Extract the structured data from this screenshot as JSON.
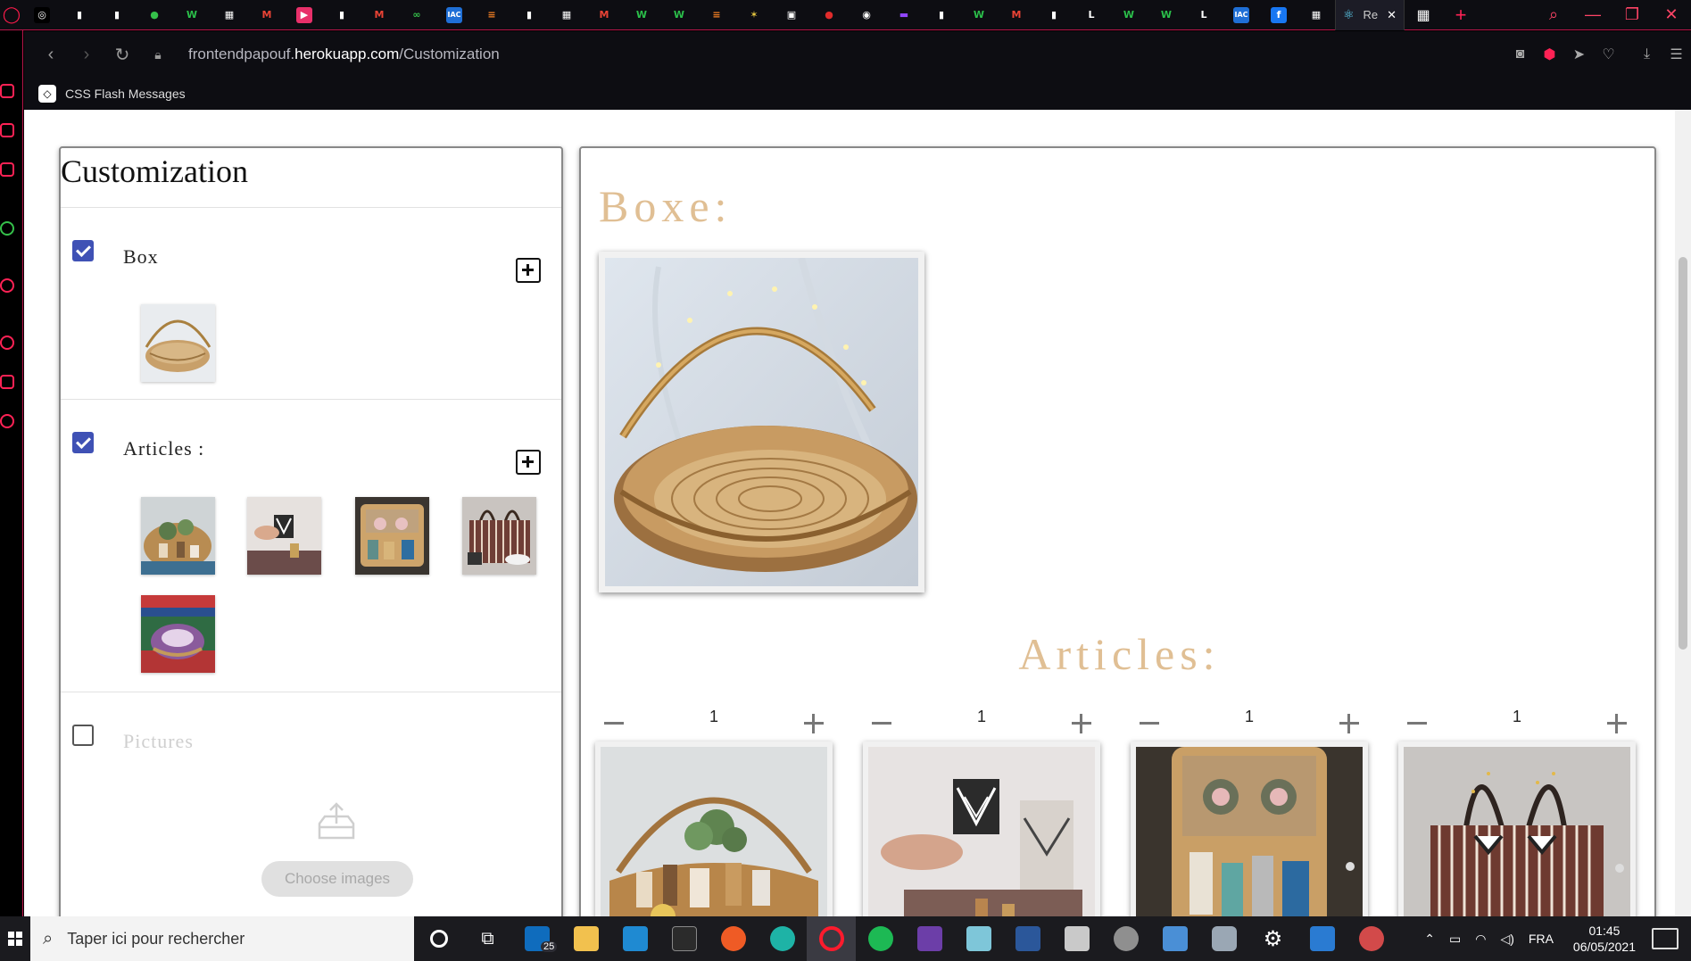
{
  "browser": {
    "active_tab_title": "Re",
    "url_prefix": "frontendpapouf.",
    "url_domain": "herokuapp.com",
    "url_path": "/Customization",
    "bookmark_label": "CSS Flash Messages",
    "tab_favicons": [
      {
        "name": "codepen-tab",
        "glyph": "◎",
        "color": "#ffffff",
        "bg": "#000000"
      },
      {
        "name": "doc-tab",
        "glyph": "▮",
        "color": "#ffffff",
        "bg": "transparent"
      },
      {
        "name": "doc-tab",
        "glyph": "▮",
        "color": "#ffffff",
        "bg": "transparent"
      },
      {
        "name": "green-tab",
        "glyph": "●",
        "color": "#35c04a",
        "bg": "transparent"
      },
      {
        "name": "w-tab",
        "glyph": "W",
        "color": "#2bbf4a",
        "bg": "transparent"
      },
      {
        "name": "grid-tab",
        "glyph": "▦",
        "color": "#ffffff",
        "bg": "transparent"
      },
      {
        "name": "gmail-tab",
        "glyph": "M",
        "color": "#ea4335",
        "bg": "transparent"
      },
      {
        "name": "play-tab",
        "glyph": "▶",
        "color": "#ffffff",
        "bg": "#e8306a"
      },
      {
        "name": "doc-tab",
        "glyph": "▮",
        "color": "#ffffff",
        "bg": "transparent"
      },
      {
        "name": "gmail-tab",
        "glyph": "M",
        "color": "#ea4335",
        "bg": "transparent"
      },
      {
        "name": "loop-tab",
        "glyph": "∞",
        "color": "#35c04a",
        "bg": "transparent"
      },
      {
        "name": "iac-tab",
        "glyph": "IAC",
        "color": "#ffffff",
        "bg": "#1f6fd6"
      },
      {
        "name": "stack-tab",
        "glyph": "≡",
        "color": "#f48024",
        "bg": "transparent"
      },
      {
        "name": "doc-tab",
        "glyph": "▮",
        "color": "#ffffff",
        "bg": "transparent"
      },
      {
        "name": "grid-tab",
        "glyph": "▦",
        "color": "#ffffff",
        "bg": "transparent"
      },
      {
        "name": "gmail-tab",
        "glyph": "M",
        "color": "#ea4335",
        "bg": "transparent"
      },
      {
        "name": "w-tab",
        "glyph": "W",
        "color": "#2bbf4a",
        "bg": "transparent"
      },
      {
        "name": "w-tab",
        "glyph": "W",
        "color": "#2bbf4a",
        "bg": "transparent"
      },
      {
        "name": "stack-tab",
        "glyph": "≡",
        "color": "#f48024",
        "bg": "transparent"
      },
      {
        "name": "spark-tab",
        "glyph": "✶",
        "color": "#e5c640",
        "bg": "transparent"
      },
      {
        "name": "img-tab",
        "glyph": "▣",
        "color": "#ffffff",
        "bg": "transparent"
      },
      {
        "name": "red-dot-tab",
        "glyph": "●",
        "color": "#e02b2b",
        "bg": "transparent"
      },
      {
        "name": "github-tab",
        "glyph": "◉",
        "color": "#ffffff",
        "bg": "transparent"
      },
      {
        "name": "twitch-tab",
        "glyph": "▬",
        "color": "#9146ff",
        "bg": "transparent"
      },
      {
        "name": "doc-tab",
        "glyph": "▮",
        "color": "#ffffff",
        "bg": "transparent"
      },
      {
        "name": "w-tab",
        "glyph": "W",
        "color": "#2bbf4a",
        "bg": "transparent"
      },
      {
        "name": "gmail-tab",
        "glyph": "M",
        "color": "#ea4335",
        "bg": "transparent"
      },
      {
        "name": "doc-tab",
        "glyph": "▮",
        "color": "#ffffff",
        "bg": "transparent"
      },
      {
        "name": "l-tab",
        "glyph": "L",
        "color": "#ffffff",
        "bg": "transparent"
      },
      {
        "name": "w-tab",
        "glyph": "W",
        "color": "#2bbf4a",
        "bg": "transparent"
      },
      {
        "name": "w-tab",
        "glyph": "W",
        "color": "#2bbf4a",
        "bg": "transparent"
      },
      {
        "name": "l-tab",
        "glyph": "L",
        "color": "#ffffff",
        "bg": "transparent"
      },
      {
        "name": "iac-tab",
        "glyph": "IAC",
        "color": "#ffffff",
        "bg": "#1f6fd6"
      },
      {
        "name": "facebook-tab",
        "glyph": "f",
        "color": "#ffffff",
        "bg": "#1877f2"
      },
      {
        "name": "grid-tab",
        "glyph": "▦",
        "color": "#ffffff",
        "bg": "transparent"
      }
    ]
  },
  "customization": {
    "title": "Customization",
    "box_label": "Box",
    "box_checked": true,
    "articles_label": "Articles :",
    "articles_checked": true,
    "pictures_label": "Pictures",
    "pictures_checked": false,
    "choose_images_label": "Choose images"
  },
  "preview": {
    "boxe_title": "Boxe:",
    "articles_title": "Articles:",
    "articles": [
      {
        "qty": "1",
        "name": "basket-with-plants"
      },
      {
        "qty": "1",
        "name": "hand-holding-cup"
      },
      {
        "qty": "1",
        "name": "open-wicker-case"
      },
      {
        "qty": "1",
        "name": "striped-bag"
      }
    ]
  },
  "taskbar": {
    "search_placeholder": "Taper ici pour rechercher",
    "mail_badge": "25",
    "language": "FRA",
    "time": "01:45",
    "date": "06/05/2021"
  }
}
